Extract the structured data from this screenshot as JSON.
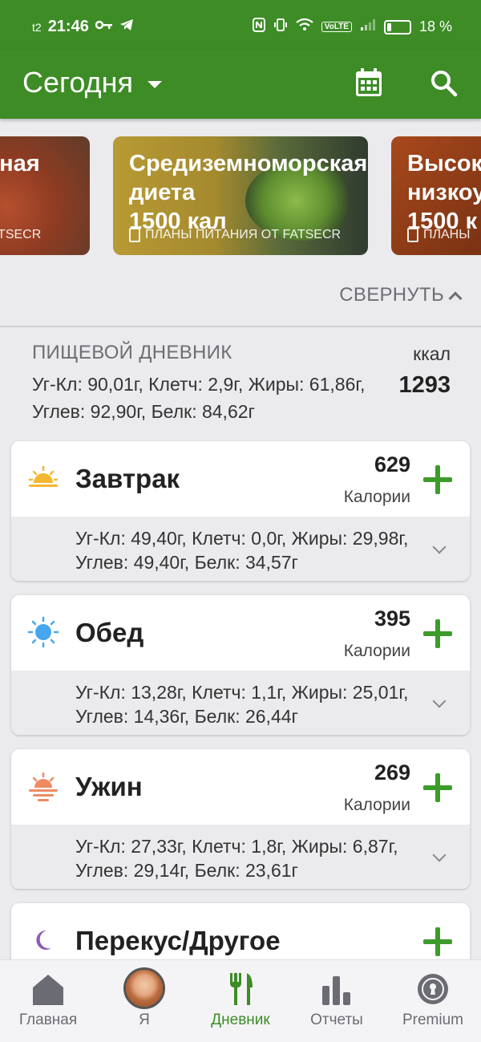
{
  "status_bar": {
    "carrier": "t2",
    "time": "21:46",
    "network_badge": "VoLTE",
    "battery": "18 %",
    "battery_level": 0.18
  },
  "app_bar": {
    "title": "Сегодня"
  },
  "plans": [
    {
      "title": "ванная",
      "kcal": "",
      "source": "Н ОТ FATSECR"
    },
    {
      "title_line1": "Средиземноморская",
      "title_line2": "диета",
      "kcal": "1500 кал",
      "source": "ПЛАНЫ ПИТАНИЯ ОТ FATSECR"
    },
    {
      "title_line1": "Высок",
      "title_line2": "низкоу",
      "kcal": "1500 к",
      "source": "ПЛАНЫ"
    }
  ],
  "collapse_label": "СВЕРНУТЬ",
  "diary": {
    "heading": "ПИЩЕВОЙ ДНЕВНИК",
    "kcal_label": "ккал",
    "total": "1293",
    "summary": "Уг-Кл: 90,01г, Клетч: 2,9г, Жиры: 61,86г, Углев: 92,90г, Белк: 84,62г"
  },
  "meals": [
    {
      "name": "Завтрак",
      "calories": "629",
      "calories_label": "Калории",
      "detail": "Уг-Кл: 49,40г, Клетч: 0,0г, Жиры: 29,98г, Углев: 49,40г, Белк: 34,57г",
      "icon": "sunrise-icon"
    },
    {
      "name": "Обед",
      "calories": "395",
      "calories_label": "Калории",
      "detail": "Уг-Кл: 13,28г, Клетч: 1,1г, Жиры: 25,01г, Углев: 14,36г, Белк: 26,44г",
      "icon": "sun-icon"
    },
    {
      "name": "Ужин",
      "calories": "269",
      "calories_label": "Калории",
      "detail": "Уг-Кл: 27,33г, Клетч: 1,8г, Жиры: 6,87г, Углев: 29,14г, Белк: 23,61г",
      "icon": "sunset-icon"
    },
    {
      "name": "Перекус/Другое",
      "icon": "moon-icon"
    }
  ],
  "nav": [
    {
      "label": "Главная"
    },
    {
      "label": "Я"
    },
    {
      "label": "Дневник",
      "active": true
    },
    {
      "label": "Отчеты"
    },
    {
      "label": "Premium"
    }
  ],
  "colors": {
    "brand_green": "#3d8c26",
    "plus_green": "#3d9b2c",
    "background": "#ebebee"
  }
}
